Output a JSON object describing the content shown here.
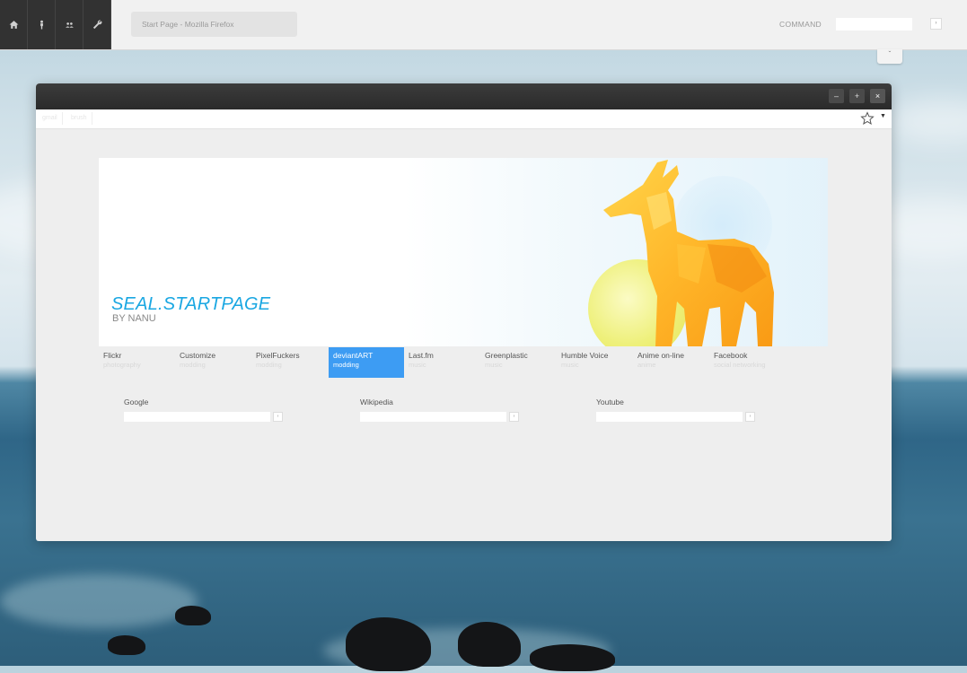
{
  "panel": {
    "icons": [
      "home-icon",
      "person-icon",
      "users-icon",
      "wrench-icon"
    ],
    "task_title": "Start Page - Mozilla Firefox",
    "command_label": "COMMAND",
    "command_value": "",
    "go_label": "›",
    "drop_label": "ˇ"
  },
  "window": {
    "minimize_label": "–",
    "maximize_label": "+",
    "close_label": "×",
    "nav_tabs": [
      "gmail",
      "brush"
    ]
  },
  "banner": {
    "title": "SEAL.STARTPAGE",
    "subtitle": "BY NANU"
  },
  "links": [
    {
      "title": "Flickr",
      "sub": "photography"
    },
    {
      "title": "Customize",
      "sub": "modding"
    },
    {
      "title": "PixelFuckers",
      "sub": "modding"
    },
    {
      "title": "deviantART",
      "sub": "modding"
    },
    {
      "title": "Last.fm",
      "sub": "music"
    },
    {
      "title": "Greenplastic",
      "sub": "music"
    },
    {
      "title": "Humble Voice",
      "sub": "music"
    },
    {
      "title": "Anime on-line",
      "sub": "anime"
    },
    {
      "title": "Facebook",
      "sub": "social networking"
    }
  ],
  "searches": [
    {
      "label": "Google",
      "value": "",
      "go": "›"
    },
    {
      "label": "Wikipedia",
      "value": "",
      "go": "›"
    },
    {
      "label": "Youtube",
      "value": "",
      "go": "›"
    }
  ],
  "colors": {
    "accent": "#1aa7e2",
    "active_link": "#3d9cf3",
    "panel_dark": "#323232"
  }
}
